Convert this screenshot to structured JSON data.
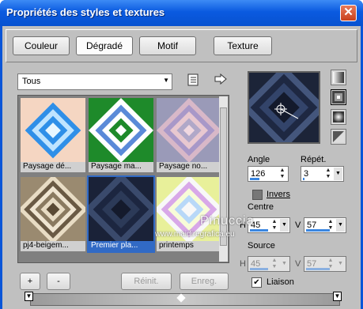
{
  "window": {
    "title": "Propriétés des styles et textures",
    "close": "✕"
  },
  "tabs": [
    "Couleur",
    "Dégradé",
    "Motif",
    "Texture"
  ],
  "active_tab": "Dégradé",
  "category": {
    "selected": "Tous",
    "arrow": "▼"
  },
  "gallery": {
    "items": [
      "Paysage dé...",
      "Paysage ma...",
      "Paysage no...",
      "pj4-beigem...",
      "Premier pla...",
      "printemps"
    ],
    "selected": "Premier pla..."
  },
  "footer_buttons": {
    "add": "+",
    "remove": "-",
    "reset": "Réinit.",
    "save": "Enreg."
  },
  "angle": {
    "label": "Angle",
    "value": "126",
    "fill": 0.35
  },
  "repeat": {
    "label": "Répét.",
    "value": "3",
    "fill": 0.03
  },
  "invert": {
    "label": "Invers",
    "checked": false
  },
  "center": {
    "label": "Centre",
    "h_label": "H",
    "h_value": "45",
    "h_fill": 0.45,
    "v_label": "V",
    "v_value": "57",
    "v_fill": 0.57
  },
  "source": {
    "label": "Source",
    "h_label": "H",
    "h_value": "45",
    "h_fill": 0.45,
    "v_label": "V",
    "v_value": "57",
    "v_fill": 0.57
  },
  "link": {
    "label": "Liaison",
    "checked": true,
    "mark": "✔"
  },
  "watermark": {
    "line1": "Pinuccia",
    "line2": "www.maidiregrafica.eu"
  },
  "colors": {
    "titlebar": "#0a5ae0",
    "selection": "#316ac5",
    "client": "#c0c0c0"
  },
  "icons": [
    "close-icon",
    "dropdown-arrow-icon",
    "catalog-icon",
    "arrow-right-icon",
    "gradient-style-icons",
    "gradient-stop-icons"
  ]
}
